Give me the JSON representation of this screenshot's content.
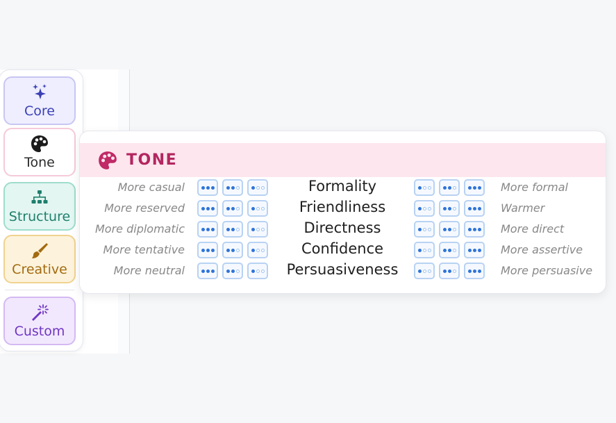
{
  "rail": {
    "categories": [
      {
        "label": "Core",
        "icon": "sparkles-icon"
      },
      {
        "label": "Tone",
        "icon": "palette-icon"
      },
      {
        "label": "Structure",
        "icon": "sitemap-icon"
      },
      {
        "label": "Creative",
        "icon": "paintbrush-icon"
      },
      {
        "label": "Custom",
        "icon": "magic-wand-icon"
      }
    ],
    "selected": "Tone"
  },
  "tone_panel": {
    "title": "TONE",
    "icon": "palette-icon",
    "rows": [
      {
        "left": "More casual",
        "name": "Formality",
        "right": "More formal"
      },
      {
        "left": "More reserved",
        "name": "Friendliness",
        "right": "Warmer"
      },
      {
        "left": "More diplomatic",
        "name": "Directness",
        "right": "More direct"
      },
      {
        "left": "More tentative",
        "name": "Confidence",
        "right": "More assertive"
      },
      {
        "left": "More neutral",
        "name": "Persuasiveness",
        "right": "More persuasive"
      }
    ],
    "left_button_levels": [
      3,
      2,
      1
    ],
    "right_button_levels": [
      1,
      2,
      3
    ]
  },
  "colors": {
    "accent": "#b3265f",
    "core": "#3a3fb4",
    "structure": "#1e7f6c",
    "creative": "#a36a10",
    "custom": "#6f36c4",
    "dot": "#2f74d8"
  }
}
